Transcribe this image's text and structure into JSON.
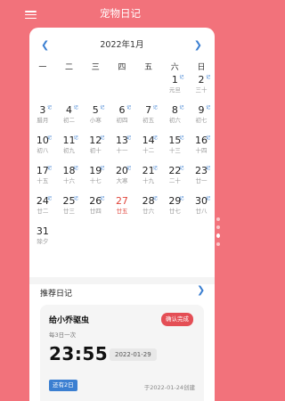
{
  "header": {
    "title": "宠物日记"
  },
  "calendar": {
    "month_label": "2022年1月",
    "weekdays": [
      "一",
      "二",
      "三",
      "四",
      "五",
      "六",
      "日"
    ],
    "days": [
      {
        "day": "1",
        "sub": "元旦",
        "tag": "记"
      },
      {
        "day": "2",
        "sub": "三十",
        "tag": "记"
      },
      {
        "day": "3",
        "sub": "腊月",
        "tag": "记"
      },
      {
        "day": "4",
        "sub": "初二",
        "tag": "记"
      },
      {
        "day": "5",
        "sub": "小寒",
        "tag": "记"
      },
      {
        "day": "6",
        "sub": "初四",
        "tag": "记"
      },
      {
        "day": "7",
        "sub": "初五",
        "tag": "记"
      },
      {
        "day": "8",
        "sub": "初六",
        "tag": "记"
      },
      {
        "day": "9",
        "sub": "初七",
        "tag": "记"
      },
      {
        "day": "10",
        "sub": "初八",
        "tag": "记"
      },
      {
        "day": "11",
        "sub": "初九",
        "tag": "记"
      },
      {
        "day": "12",
        "sub": "初十",
        "tag": "记"
      },
      {
        "day": "13",
        "sub": "十一",
        "tag": "记"
      },
      {
        "day": "14",
        "sub": "十二",
        "tag": "记"
      },
      {
        "day": "15",
        "sub": "十三",
        "tag": "记"
      },
      {
        "day": "16",
        "sub": "十四",
        "tag": "记"
      },
      {
        "day": "17",
        "sub": "十五",
        "tag": "记"
      },
      {
        "day": "18",
        "sub": "十六",
        "tag": "记"
      },
      {
        "day": "19",
        "sub": "十七",
        "tag": "记"
      },
      {
        "day": "20",
        "sub": "大寒",
        "tag": "记"
      },
      {
        "day": "21",
        "sub": "十九",
        "tag": "记"
      },
      {
        "day": "22",
        "sub": "二十",
        "tag": "记"
      },
      {
        "day": "23",
        "sub": "廿一",
        "tag": "记"
      },
      {
        "day": "24",
        "sub": "廿二",
        "tag": "记"
      },
      {
        "day": "25",
        "sub": "廿三",
        "tag": "记"
      },
      {
        "day": "26",
        "sub": "廿四",
        "tag": "记"
      },
      {
        "day": "27",
        "sub": "廿五",
        "tag": "",
        "today": true
      },
      {
        "day": "28",
        "sub": "廿六",
        "tag": "记"
      },
      {
        "day": "29",
        "sub": "廿七",
        "tag": "记"
      },
      {
        "day": "30",
        "sub": "廿八",
        "tag": "记"
      },
      {
        "day": "31",
        "sub": "除夕",
        "tag": ""
      }
    ],
    "first_weekday_index": 5
  },
  "recommend": {
    "title": "推荐日记",
    "item": {
      "name": "给小乔驱虫",
      "frequency": "每3日一次",
      "confirm_label": "确认完成",
      "time": "23:55",
      "date": "2022-01-29",
      "remaining": "还有2日",
      "created": "于2022-01-24创建"
    }
  },
  "colors": {
    "background": "#f2727b",
    "accent": "#3b7fd1",
    "confirm": "#e44e55",
    "today": "#e0463c"
  }
}
